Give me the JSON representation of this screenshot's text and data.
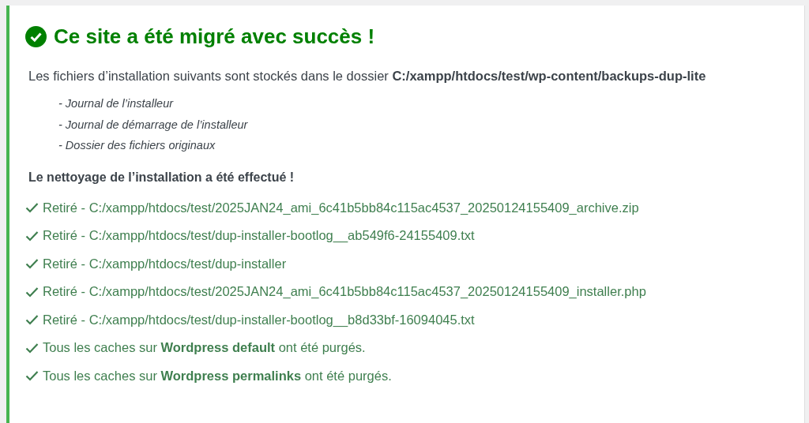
{
  "notice": {
    "title": "Ce site a été migré avec succès !",
    "intro": "Les fichiers d’installation suivants sont stockés dans le dossier **C:/xampp/htdocs/test/wp-content/backups-dup-lite**",
    "files": [
      "- Journal de l’installeur",
      "- Journal de démarrage de l’installeur",
      "- Dossier des fichiers originaux"
    ],
    "cleanup_heading": "Le nettoyage de l’installation a été effectué !",
    "results": [
      {
        "text": "Retiré - C:/xampp/htdocs/test/2025JAN24_ami_6c41b5bb84c115ac4537_20250124155409_archive.zip"
      },
      {
        "text": "Retiré - C:/xampp/htdocs/test/dup-installer-bootlog__ab549f6-24155409.txt"
      },
      {
        "text": "Retiré - C:/xampp/htdocs/test/dup-installer"
      },
      {
        "text": "Retiré - C:/xampp/htdocs/test/2025JAN24_ami_6c41b5bb84c115ac4537_20250124155409_installer.php"
      },
      {
        "text": "Retiré - C:/xampp/htdocs/test/dup-installer-bootlog__b8d33bf-16094045.txt"
      },
      {
        "text": "Tous les caches sur **Wordpress default** ont été purgés."
      },
      {
        "text": "Tous les caches sur **Wordpress permalinks** ont été purgés."
      }
    ]
  }
}
